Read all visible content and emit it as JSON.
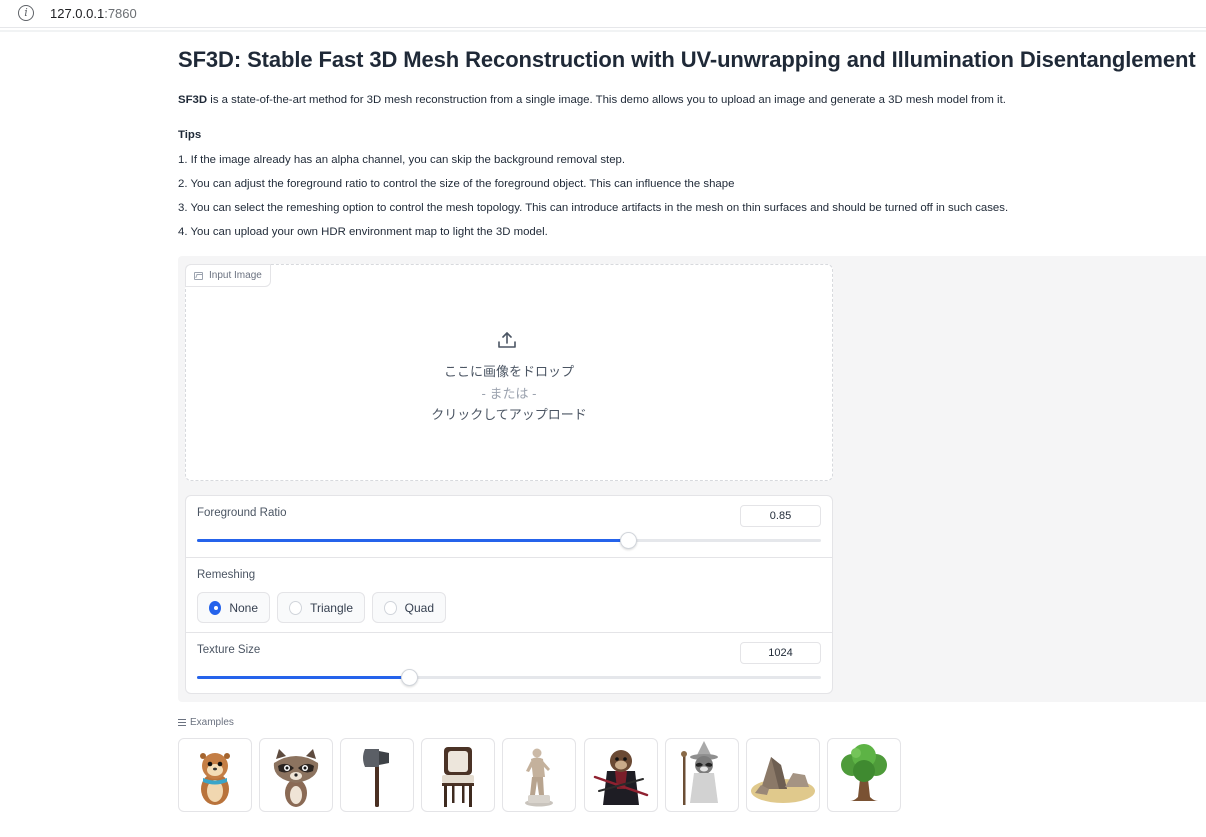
{
  "browser": {
    "host": "127.0.0.1",
    "port": ":7860"
  },
  "header": {
    "title": "SF3D: Stable Fast 3D Mesh Reconstruction with UV-unwrapping and Illumination Disentanglement",
    "intro_bold": "SF3D",
    "intro_rest": " is a state-of-the-art method for 3D mesh reconstruction from a single image. This demo allows you to upload an image and generate a 3D mesh model from it."
  },
  "tips": {
    "heading": "Tips",
    "items": [
      "1. If the image already has an alpha channel, you can skip the background removal step.",
      "2. You can adjust the foreground ratio to control the size of the foreground object. This can influence the shape",
      "3. You can select the remeshing option to control the mesh topology. This can introduce artifacts in the mesh on thin surfaces and should be turned off in such cases.",
      "4. You can upload your own HDR environment map to light the 3D model."
    ]
  },
  "input_image": {
    "label": "Input Image",
    "icon": "image-icon",
    "upload_icon": "upload-icon",
    "drop_line1": "ここに画像をドロップ",
    "drop_line2": "- または -",
    "drop_line3": "クリックしてアップロード"
  },
  "foreground_ratio": {
    "label": "Foreground Ratio",
    "value": "0.85",
    "fraction": 0.69
  },
  "remeshing": {
    "label": "Remeshing",
    "options": [
      "None",
      "Triangle",
      "Quad"
    ],
    "selected": "None"
  },
  "texture_size": {
    "label": "Texture Size",
    "value": "1024",
    "fraction": 0.34
  },
  "examples": {
    "label": "Examples",
    "items": [
      "otter-thumbnail",
      "raccoon-thumbnail",
      "axe-thumbnail",
      "chair-thumbnail",
      "statue-thumbnail",
      "samurai-otter-thumbnail",
      "wizard-raccoon-thumbnail",
      "rocks-thumbnail",
      "tree-thumbnail"
    ]
  },
  "colors": {
    "accent": "#2563eb",
    "panel_bg": "#f5f5f6",
    "border": "#e4e4e7"
  }
}
